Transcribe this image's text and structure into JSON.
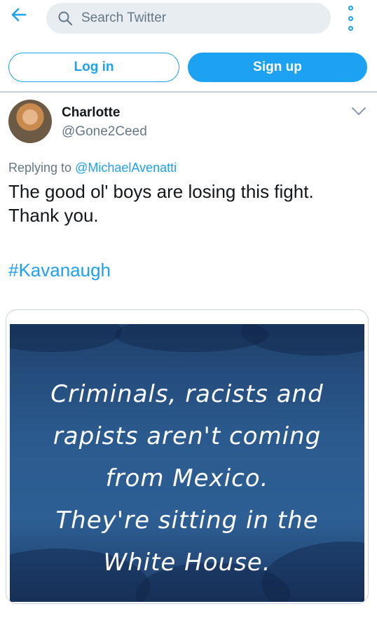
{
  "topbar": {
    "search_placeholder": "Search Twitter",
    "back_icon": "back-arrow-icon",
    "more_icon": "more-vertical-icon"
  },
  "auth": {
    "login_label": "Log in",
    "signup_label": "Sign up"
  },
  "tweet": {
    "display_name": "Charlotte",
    "handle": "@Gone2Ceed",
    "replying_prefix": "Replying to",
    "replying_mention": "@MichaelAvenatti",
    "text_lines": [
      "The good ol' boys are losing this fight.",
      "Thank you."
    ],
    "hashtag": "#Kavanaugh",
    "media_lines": [
      "Criminals, racists and",
      "rapists aren't coming",
      "from Mexico.",
      "They're sitting in the",
      "White House."
    ]
  },
  "colors": {
    "accent": "#1da1f2",
    "secondary_text": "#657786",
    "search_bg": "#e8edf1",
    "media_bg": "#2b5a8e"
  }
}
